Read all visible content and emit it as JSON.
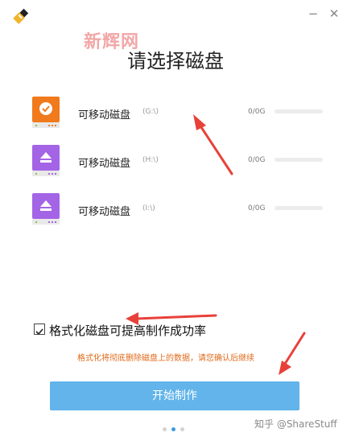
{
  "window": {
    "app_icon": "usb-drive-icon",
    "minimize_glyph": "−",
    "close_glyph": "✕"
  },
  "watermark_text": "新辉网",
  "title": "请选择磁盘",
  "disks": [
    {
      "name": "可移动磁盘",
      "letter": "(G:\\)",
      "size": "0/0G",
      "icon": "disk-selected-icon",
      "color": "#f07a1c",
      "selected": true
    },
    {
      "name": "可移动磁盘",
      "letter": "(H:\\)",
      "size": "0/0G",
      "icon": "disk-eject-icon",
      "color": "#a464e6",
      "selected": false
    },
    {
      "name": "可移动磁盘",
      "letter": "(I:\\)",
      "size": "0/0G",
      "icon": "disk-eject-icon",
      "color": "#a464e6",
      "selected": false
    }
  ],
  "format_option": {
    "label": "格式化磁盘可提高制作成功率",
    "checked": true
  },
  "warning_text": "格式化将彻底删除磁盘上的数据，请您确认后继续",
  "start_button_label": "开始制作",
  "pagination": {
    "count": 3,
    "active": 1
  },
  "footer_watermark": "知乎 @ShareStuff",
  "colors": {
    "accent": "#62b4ea",
    "warning": "#e06a1a",
    "arrow": "#e8413a"
  }
}
